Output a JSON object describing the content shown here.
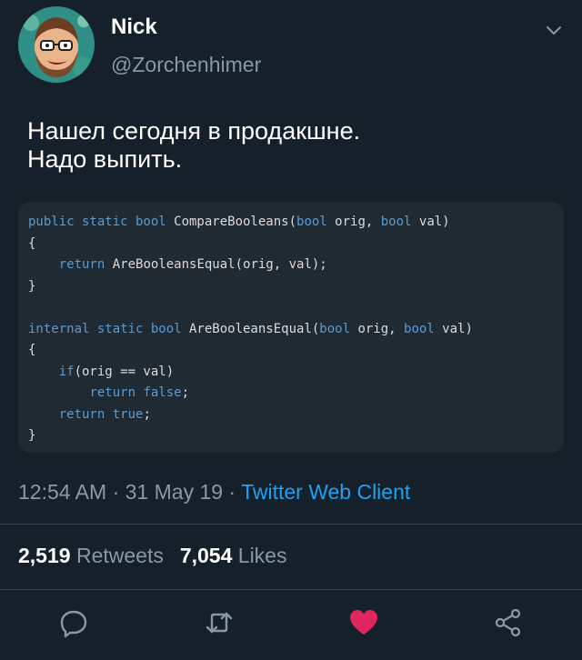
{
  "user": {
    "display_name": "Nick",
    "handle": "@Zorchenhimer"
  },
  "tweet": {
    "text": "Нашел сегодня в продакшне.\nНадо выпить.",
    "code_lines": [
      [
        {
          "t": "public static bool",
          "k": true
        },
        {
          "t": " CompareBooleans(",
          "k": false
        },
        {
          "t": "bool",
          "k": true
        },
        {
          "t": " orig, ",
          "k": false
        },
        {
          "t": "bool",
          "k": true
        },
        {
          "t": " val)",
          "k": false
        }
      ],
      [
        {
          "t": "{",
          "k": false
        }
      ],
      [
        {
          "t": "    ",
          "k": false
        },
        {
          "t": "return",
          "k": true
        },
        {
          "t": " AreBooleansEqual(orig, val);",
          "k": false
        }
      ],
      [
        {
          "t": "}",
          "k": false
        }
      ],
      [],
      [
        {
          "t": "internal static bool",
          "k": true
        },
        {
          "t": " AreBooleansEqual(",
          "k": false
        },
        {
          "t": "bool",
          "k": true
        },
        {
          "t": " orig, ",
          "k": false
        },
        {
          "t": "bool",
          "k": true
        },
        {
          "t": " val)",
          "k": false
        }
      ],
      [
        {
          "t": "{",
          "k": false
        }
      ],
      [
        {
          "t": "    ",
          "k": false
        },
        {
          "t": "if",
          "k": true
        },
        {
          "t": "(orig == val)",
          "k": false
        }
      ],
      [
        {
          "t": "        ",
          "k": false
        },
        {
          "t": "return false",
          "k": true
        },
        {
          "t": ";",
          "k": false
        }
      ],
      [
        {
          "t": "    ",
          "k": false
        },
        {
          "t": "return true",
          "k": true
        },
        {
          "t": ";",
          "k": false
        }
      ],
      [
        {
          "t": "}",
          "k": false
        }
      ]
    ]
  },
  "meta": {
    "time": "12:54 AM",
    "separator": " · ",
    "date": "31 May 19",
    "client": "Twitter Web Client"
  },
  "stats": {
    "retweets_count": "2,519",
    "retweets_label": "Retweets",
    "likes_count": "7,054",
    "likes_label": "Likes"
  },
  "actions": {
    "reply_icon": "reply-icon",
    "retweet_icon": "retweet-icon",
    "like_icon": "heart-icon",
    "share_icon": "share-icon"
  },
  "colors": {
    "background": "#15202b",
    "accent": "#1da1f2",
    "like": "#e0245e",
    "muted": "#8899a6",
    "code_keyword": "#569cd6"
  }
}
